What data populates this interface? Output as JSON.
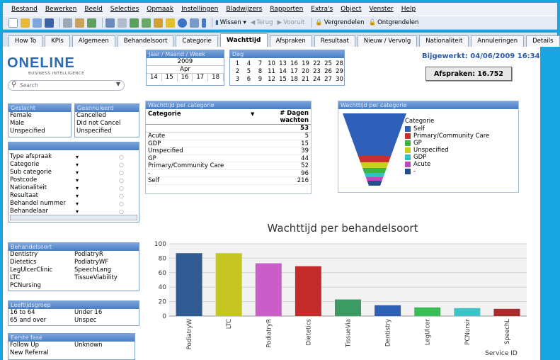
{
  "menu": [
    "Bestand",
    "Bewerken",
    "Beeld",
    "Selecties",
    "Opmaak",
    "Instellingen",
    "Bladwijzers",
    "Rapporten",
    "Extra's",
    "Object",
    "Venster",
    "Help"
  ],
  "toolbar": {
    "wissen": "Wissen",
    "terug": "Terug",
    "vooruit": "Vooruit",
    "vergrendelen": "Vergrendelen",
    "ontgrendelen": "Ontgrendelen"
  },
  "tabs": [
    "How To",
    "KPIs",
    "Algemeen",
    "Behandelsoort",
    "Categorie",
    "Wachttijd",
    "Afspraken",
    "Resultaat",
    "Nieuw / Vervolg",
    "Nationaliteit",
    "Annuleringen",
    "Details"
  ],
  "active_tab": "Wachttijd",
  "logo": {
    "main": "ONELINE",
    "sub": "BUSINESS INTELLIGENCE"
  },
  "search": {
    "placeholder": "Search"
  },
  "date_box": {
    "title": "Jaar / Maand / Week",
    "year": "2009",
    "month": "Apr",
    "weeks": [
      "14",
      "15",
      "16",
      "17",
      "18"
    ]
  },
  "dag_box": {
    "title": "Dag",
    "days": [
      "1",
      "4",
      "7",
      "10",
      "13",
      "16",
      "19",
      "22",
      "25",
      "28",
      "2",
      "5",
      "8",
      "11",
      "14",
      "17",
      "20",
      "23",
      "26",
      "29",
      "3",
      "6",
      "9",
      "12",
      "15",
      "18",
      "21",
      "24",
      "27",
      "30"
    ]
  },
  "updated": "Bijgewerkt: 04/06/2009 16:34:52",
  "afspraken": "Afspraken: 16.752",
  "geslacht": {
    "title": "Geslacht",
    "items": [
      "Female",
      "Male",
      "Unspecified"
    ]
  },
  "geannuleerd": {
    "title": "Geannuleerd",
    "items": [
      "Cancelled",
      "Did not Cancel",
      "Unspecified"
    ]
  },
  "fields": [
    "Type afspraak",
    "Categorie",
    "Sub categorie",
    "Postcode",
    "Nationaliteit",
    "Resultaat",
    "Behandel nummer",
    "Behandelaar"
  ],
  "behandelsoort": {
    "title": "Behandelsoort",
    "col1": [
      "Dentistry",
      "Dietetics",
      "LegUlcerClinic",
      "LTC",
      "PCNursing"
    ],
    "col2": [
      "PodiatryR",
      "PodiatryWF",
      "SpeechLang",
      "TissueViability"
    ]
  },
  "leeftijd": {
    "title": "Leeftijdsgroep",
    "col1": [
      "16 to 64",
      "65 and over"
    ],
    "col2": [
      "Under 16",
      "Unspec"
    ]
  },
  "eerste_fase": {
    "title": "Eerste fase",
    "col1": [
      "Follow Up",
      "New Referral"
    ],
    "col2": [
      "Unknown"
    ]
  },
  "table": {
    "title": "Wachttijd per categorie",
    "col1": "Categorie",
    "col2a": "# Dagen",
    "col2b": "wachten",
    "total": "53",
    "rows": [
      [
        "Acute",
        "5"
      ],
      [
        "GDP",
        "15"
      ],
      [
        "Unspecified",
        "39"
      ],
      [
        "GP",
        "44"
      ],
      [
        "Primary/Community Care",
        "52"
      ],
      [
        "-",
        "96"
      ],
      [
        "Self",
        "216"
      ]
    ]
  },
  "funnel": {
    "title": "Wachttijd per categorie",
    "legend_title": "Categorie",
    "legend": [
      "Self",
      "Primary/Community Care",
      "GP",
      "Unspecified",
      "GDP",
      "Acute",
      "-"
    ],
    "colors": [
      "#2f5fb8",
      "#c8302f",
      "#3fb43f",
      "#c8cf1e",
      "#30c2c2",
      "#c048c0",
      "#244e8c"
    ]
  },
  "chart_data": {
    "type": "bar",
    "title": "Wachttijd per behandelsoort",
    "xlabel": "Service ID",
    "ylabel": "",
    "ylim": [
      0,
      100
    ],
    "yticks": [
      0,
      20,
      40,
      60,
      80,
      100
    ],
    "categories": [
      "PodiatryW",
      "LTC",
      "PodiatryR",
      "Dietetics",
      "TissueVia",
      "Dentistry",
      "LegUlcer",
      "PCNursir",
      "SpeechL"
    ],
    "values": [
      87,
      87,
      73,
      69,
      23,
      15,
      12,
      11,
      10
    ],
    "colors": [
      "#2f5a92",
      "#c6c623",
      "#c95ec9",
      "#c42c2c",
      "#3c9a64",
      "#2f5fb4",
      "#39bd55",
      "#3cc3c8",
      "#a82c2c"
    ]
  }
}
